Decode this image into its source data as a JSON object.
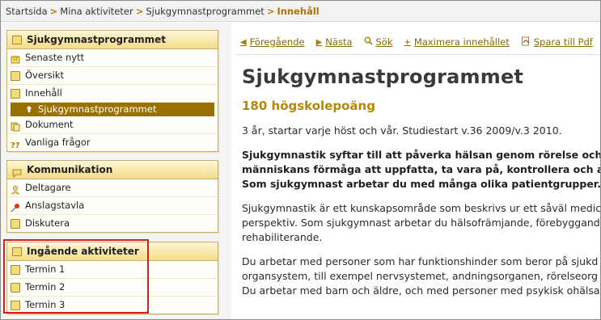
{
  "breadcrumb": {
    "items": [
      "Startsida",
      "Mina aktiviteter",
      "Sjukgymnastprogrammet"
    ],
    "separator": ">",
    "current": "Innehåll"
  },
  "sidebar": {
    "program": {
      "title": "Sjukgymnastprogrammet",
      "items": [
        {
          "label": "Senaste nytt",
          "icon": "news-star-icon"
        },
        {
          "label": "Översikt",
          "icon": "book-icon"
        },
        {
          "label": "Innehåll",
          "icon": "book-icon"
        },
        {
          "label": "Sjukgymnastprogrammet",
          "icon": "pin-icon",
          "selected": true
        },
        {
          "label": "Dokument",
          "icon": "documents-icon"
        },
        {
          "label": "Vanliga frågor",
          "icon": "faq-icon"
        }
      ]
    },
    "communication": {
      "title": "Kommunikation",
      "items": [
        {
          "label": "Deltagare",
          "icon": "person-icon"
        },
        {
          "label": "Anslagstavla",
          "icon": "pushpin-icon"
        },
        {
          "label": "Diskutera",
          "icon": "book-icon"
        }
      ]
    },
    "activities": {
      "title": "Ingående aktiviteter",
      "items": [
        {
          "label": "Termin 1",
          "icon": "book-icon"
        },
        {
          "label": "Termin 2",
          "icon": "book-icon"
        },
        {
          "label": "Termin 3",
          "icon": "book-icon"
        }
      ]
    }
  },
  "toolbar": {
    "previous": "Föregående",
    "next": "Nästa",
    "search": "Sök",
    "maximize": "Maximera innehållet",
    "save_pdf": "Spara till Pdf"
  },
  "content": {
    "title": "Sjukgymnastprogrammet",
    "credits": "180 högskolepoäng",
    "intro": "3 år, startar varje höst och vår. Studiestart v.36 2009/v.3 2010.",
    "bold_lines": [
      "Sjukgymnastik syftar till att påverka hälsan genom rörelse och fysi",
      "människans förmåga att uppfatta, ta vara på, kontrollera och använ",
      "Som sjukgymnast arbetar du med många olika patientgrupper."
    ],
    "para2_lines": [
      "Sjukgymnastik är ett kunskapsområde som beskrivs ur ett såväl medic",
      "perspektiv. Som sjukgymnast arbetar du hälsofrämjande, förebyggand",
      "rehabiliterande."
    ],
    "para3_lines": [
      "Du arbetar med personer som har funktionshinder som beror på sjukd",
      "organsystem, till exempel nervsystemet, andningsorganen, rörelseorg",
      "Du arbetar med barn och äldre, och med personer med psykisk ohälsa"
    ]
  },
  "colors": {
    "accent": "#a97700",
    "selected_bg": "#9a7100",
    "box_border": "#c8b26a",
    "highlight": "#d22020"
  }
}
